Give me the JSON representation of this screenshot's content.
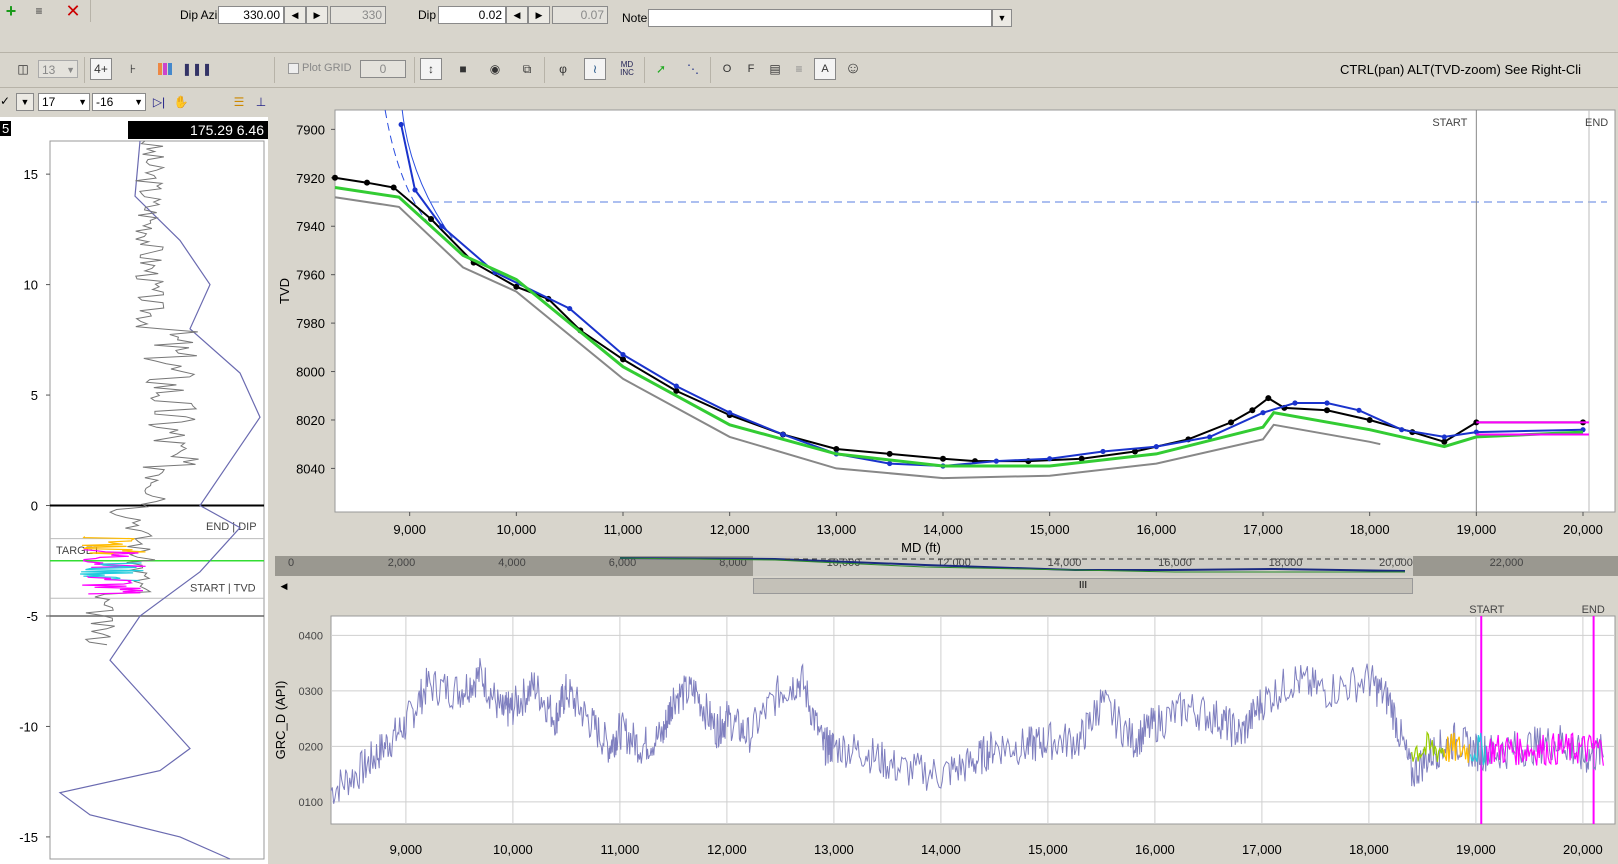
{
  "top_toolbar": {
    "dip_azi_label": "Dip Azi",
    "dip_azi_value": "330.00",
    "dip_azi_readonly": "330",
    "dip_label": "Dip",
    "dip_value": "0.02",
    "dip_readonly": "0.07",
    "note_label": "Note",
    "note_value": ""
  },
  "second_toolbar": {
    "count_value": "13",
    "zoom_label": "4+",
    "plot_grid_label": "Plot GRID",
    "plot_grid_value": "0",
    "md_inc_label": "MD INC",
    "o_label": "O",
    "f_label": "F",
    "a_label": "A",
    "hint_text": "CTRL(pan) ALT(TVD-zoom) See Right-Cli"
  },
  "left_panel": {
    "select_a": "17",
    "select_b": "-16",
    "readout": "175.29  6.46",
    "left_edge_label": "5",
    "y_ticks": [
      "15",
      "10",
      "5",
      "0",
      "-5",
      "-10",
      "-15"
    ],
    "label_end_dip": "END | DIP",
    "label_target": "TARGET",
    "label_start_tvd": "START | TVD"
  },
  "main_chart": {
    "y_axis_label": "TVD",
    "x_axis_label": "MD (ft)",
    "start_label": "START",
    "end_label": "END"
  },
  "overview": {
    "ticks": [
      "0",
      "2,000",
      "4,000",
      "6,000",
      "8,000",
      "10,000",
      "12,000",
      "14,000",
      "16,000",
      "18,000",
      "20,000",
      "22,000"
    ],
    "scroll_grip": "III"
  },
  "gamma_chart": {
    "y_axis_label": "GRC_D (API)",
    "start_label": "START",
    "end_label": "END"
  },
  "chart_data": [
    {
      "type": "line",
      "name": "tvd_vs_md",
      "xlabel": "MD (ft)",
      "ylabel": "TVD",
      "xlim": [
        8300,
        20300
      ],
      "ylim": [
        8058,
        7892
      ],
      "x_ticks": [
        9000,
        10000,
        11000,
        12000,
        13000,
        14000,
        15000,
        16000,
        17000,
        18000,
        19000,
        20000
      ],
      "y_ticks": [
        7900,
        7920,
        7940,
        7960,
        7980,
        8000,
        8020,
        8040
      ],
      "series": [
        {
          "role": "wellpath",
          "color": "#000000",
          "points": [
            [
              8300,
              7920
            ],
            [
              8600,
              7922
            ],
            [
              8850,
              7924
            ],
            [
              9200,
              7937
            ],
            [
              9600,
              7955
            ],
            [
              10000,
              7965
            ],
            [
              10300,
              7970
            ],
            [
              10600,
              7983
            ],
            [
              11000,
              7995
            ],
            [
              11500,
              8008
            ],
            [
              12000,
              8018
            ],
            [
              12500,
              8026
            ],
            [
              13000,
              8032
            ],
            [
              13500,
              8034
            ],
            [
              14000,
              8036
            ],
            [
              14300,
              8037
            ],
            [
              14800,
              8037
            ],
            [
              15300,
              8036
            ],
            [
              15800,
              8033
            ],
            [
              16300,
              8028
            ],
            [
              16700,
              8021
            ],
            [
              16900,
              8016
            ],
            [
              17050,
              8011
            ],
            [
              17200,
              8015
            ],
            [
              17600,
              8016
            ],
            [
              18000,
              8020
            ],
            [
              18400,
              8025
            ],
            [
              18700,
              8029
            ],
            [
              19000,
              8021
            ],
            [
              20000,
              8021
            ]
          ]
        },
        {
          "role": "projection",
          "color": "#1a33cc",
          "points": [
            [
              8920,
              7898
            ],
            [
              9050,
              7925
            ],
            [
              9300,
              7940
            ],
            [
              9800,
              7959
            ],
            [
              10500,
              7974
            ],
            [
              11000,
              7993
            ],
            [
              11500,
              8006
            ],
            [
              12000,
              8017
            ],
            [
              12500,
              8026
            ],
            [
              13000,
              8034
            ],
            [
              13500,
              8038
            ],
            [
              14000,
              8039
            ],
            [
              14500,
              8037
            ],
            [
              15000,
              8036
            ],
            [
              15500,
              8033
            ],
            [
              16000,
              8031
            ],
            [
              16500,
              8027
            ],
            [
              17000,
              8017
            ],
            [
              17300,
              8013
            ],
            [
              17600,
              8013
            ],
            [
              17900,
              8016
            ],
            [
              18300,
              8024
            ],
            [
              18700,
              8027
            ],
            [
              19000,
              8025
            ],
            [
              20000,
              8024
            ]
          ]
        },
        {
          "role": "target_band",
          "color": "#33cc33",
          "points": [
            [
              8300,
              7924
            ],
            [
              8900,
              7928
            ],
            [
              9500,
              7952
            ],
            [
              10000,
              7962
            ],
            [
              11000,
              7998
            ],
            [
              12000,
              8022
            ],
            [
              13000,
              8034
            ],
            [
              14000,
              8039
            ],
            [
              15000,
              8039
            ],
            [
              16000,
              8034
            ],
            [
              17000,
              8023
            ],
            [
              17100,
              8017
            ],
            [
              18000,
              8024
            ],
            [
              18700,
              8031
            ],
            [
              19000,
              8027
            ],
            [
              20000,
              8025
            ]
          ]
        },
        {
          "role": "lower_bound",
          "color": "#888888",
          "points": [
            [
              8300,
              7928
            ],
            [
              8900,
              7932
            ],
            [
              9500,
              7957
            ],
            [
              10000,
              7967
            ],
            [
              11000,
              8003
            ],
            [
              12000,
              8027
            ],
            [
              13000,
              8040
            ],
            [
              14000,
              8044
            ],
            [
              15000,
              8043
            ],
            [
              16000,
              8038
            ],
            [
              17000,
              8028
            ],
            [
              17100,
              8022
            ],
            [
              18000,
              8029
            ],
            [
              18100,
              8030
            ]
          ]
        },
        {
          "role": "start_end_markers",
          "color": "#ff00ff",
          "points": [
            [
              19000,
              8021
            ],
            [
              20000,
              8021
            ],
            [
              19000,
              8026
            ],
            [
              20000,
              8026
            ]
          ]
        }
      ],
      "reference_line_tvd": 7930
    },
    {
      "type": "line",
      "name": "gamma_ray",
      "ylabel": "GRC_D (API)",
      "xlim": [
        8300,
        20300
      ],
      "ylim": [
        60,
        435
      ],
      "x_ticks": [
        9000,
        10000,
        11000,
        12000,
        13000,
        14000,
        15000,
        16000,
        17000,
        18000,
        19000,
        20000
      ],
      "y_ticks": [
        "0100",
        "0200",
        "0300",
        "0400"
      ],
      "series": [
        {
          "role": "gamma_ray",
          "color": "#7f7fbf",
          "points": [
            [
              8300,
              120
            ],
            [
              8600,
              160
            ],
            [
              8800,
              200
            ],
            [
              9000,
              240
            ],
            [
              9200,
              310
            ],
            [
              9500,
              300
            ],
            [
              9700,
              330
            ],
            [
              9900,
              260
            ],
            [
              10000,
              270
            ],
            [
              10200,
              310
            ],
            [
              10400,
              250
            ],
            [
              10500,
              300
            ],
            [
              10700,
              250
            ],
            [
              10900,
              200
            ],
            [
              11000,
              230
            ],
            [
              11200,
              200
            ],
            [
              11400,
              220
            ],
            [
              11500,
              290
            ],
            [
              11700,
              300
            ],
            [
              11900,
              230
            ],
            [
              12000,
              250
            ],
            [
              12200,
              220
            ],
            [
              12500,
              300
            ],
            [
              12700,
              320
            ],
            [
              12900,
              200
            ],
            [
              13000,
              200
            ],
            [
              13300,
              190
            ],
            [
              13600,
              160
            ],
            [
              14000,
              150
            ],
            [
              14300,
              170
            ],
            [
              14500,
              200
            ],
            [
              14800,
              200
            ],
            [
              15000,
              210
            ],
            [
              15300,
              210
            ],
            [
              15500,
              280
            ],
            [
              15800,
              210
            ],
            [
              16000,
              240
            ],
            [
              16300,
              270
            ],
            [
              16600,
              250
            ],
            [
              16800,
              220
            ],
            [
              17000,
              280
            ],
            [
              17300,
              320
            ],
            [
              17600,
              300
            ],
            [
              18000,
              320
            ],
            [
              18200,
              280
            ],
            [
              18400,
              150
            ],
            [
              18600,
              190
            ],
            [
              18800,
              210
            ],
            [
              19000,
              190
            ],
            [
              19200,
              190
            ],
            [
              19500,
              200
            ],
            [
              19800,
              210
            ],
            [
              20000,
              180
            ],
            [
              20200,
              190
            ]
          ]
        }
      ]
    },
    {
      "type": "line",
      "name": "left_log_track",
      "ylim": [
        16.5,
        -16
      ],
      "y_ticks": [
        15,
        10,
        5,
        0,
        -5,
        -10,
        -15
      ],
      "reference_lines": [
        0,
        -2.5,
        -5
      ]
    }
  ]
}
